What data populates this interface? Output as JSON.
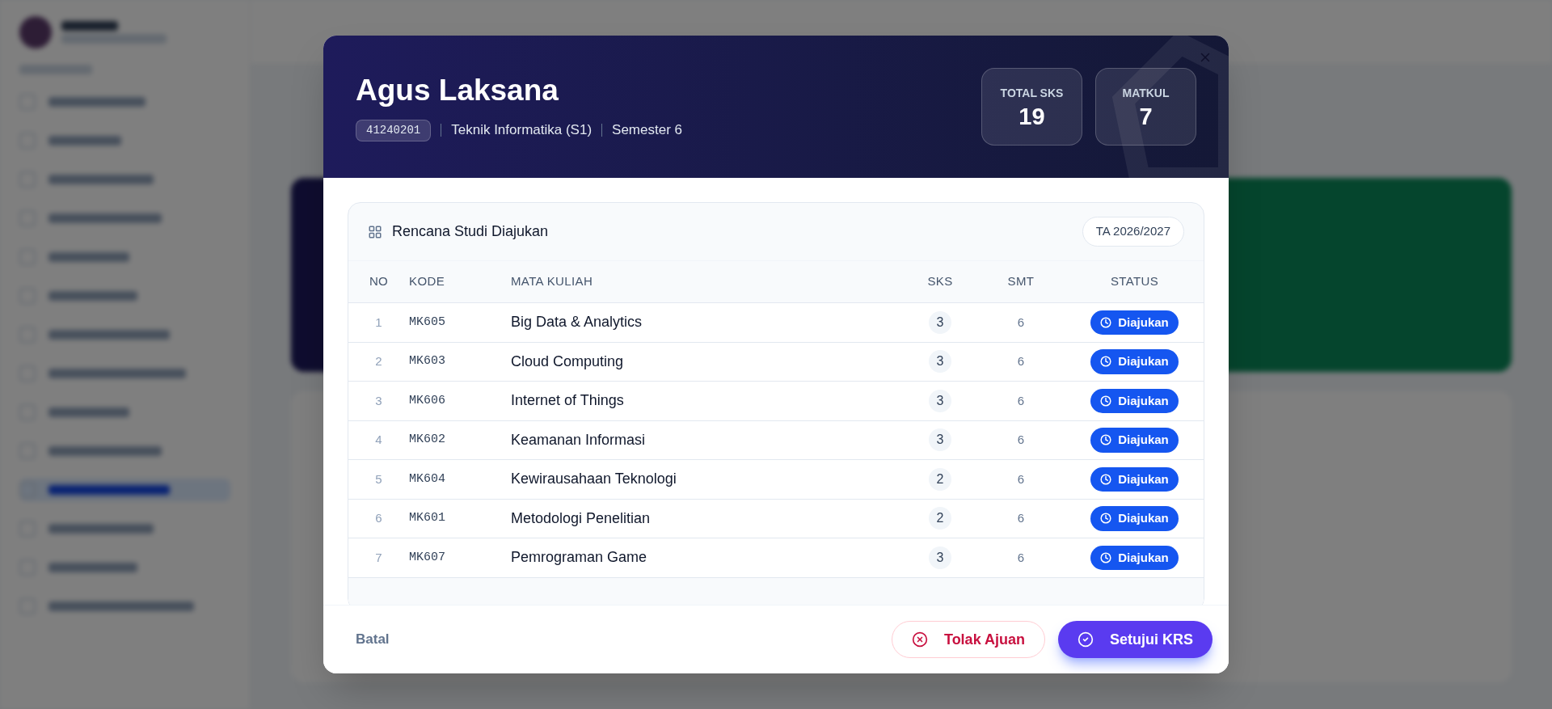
{
  "modal": {
    "student_name": "Agus Laksana",
    "student_id": "41240201",
    "program": "Teknik Informatika (S1)",
    "semester": "Semester 6",
    "stats": [
      {
        "label": "TOTAL SKS",
        "value": "19"
      },
      {
        "label": "MATKUL",
        "value": "7"
      }
    ],
    "card": {
      "title": "Rencana Studi Diajukan",
      "year_badge": "TA 2026/2027"
    },
    "table": {
      "columns": [
        "NO",
        "KODE",
        "MATA KULIAH",
        "SKS",
        "SMT",
        "STATUS"
      ],
      "rows": [
        {
          "no": "1",
          "code": "MK605",
          "course": "Big Data & Analytics",
          "sks": "3",
          "smt": "6",
          "status": "Diajukan"
        },
        {
          "no": "2",
          "code": "MK603",
          "course": "Cloud Computing",
          "sks": "3",
          "smt": "6",
          "status": "Diajukan"
        },
        {
          "no": "3",
          "code": "MK606",
          "course": "Internet of Things",
          "sks": "3",
          "smt": "6",
          "status": "Diajukan"
        },
        {
          "no": "4",
          "code": "MK602",
          "course": "Keamanan Informasi",
          "sks": "3",
          "smt": "6",
          "status": "Diajukan"
        },
        {
          "no": "5",
          "code": "MK604",
          "course": "Kewirausahaan Teknologi",
          "sks": "2",
          "smt": "6",
          "status": "Diajukan"
        },
        {
          "no": "6",
          "code": "MK601",
          "course": "Metodologi Penelitian",
          "sks": "2",
          "smt": "6",
          "status": "Diajukan"
        },
        {
          "no": "7",
          "code": "MK607",
          "course": "Pemrograman Game",
          "sks": "3",
          "smt": "6",
          "status": "Diajukan"
        }
      ]
    },
    "footer": {
      "cancel": "Batal",
      "reject": "Tolak Ajuan",
      "approve": "Setujui KRS"
    }
  }
}
